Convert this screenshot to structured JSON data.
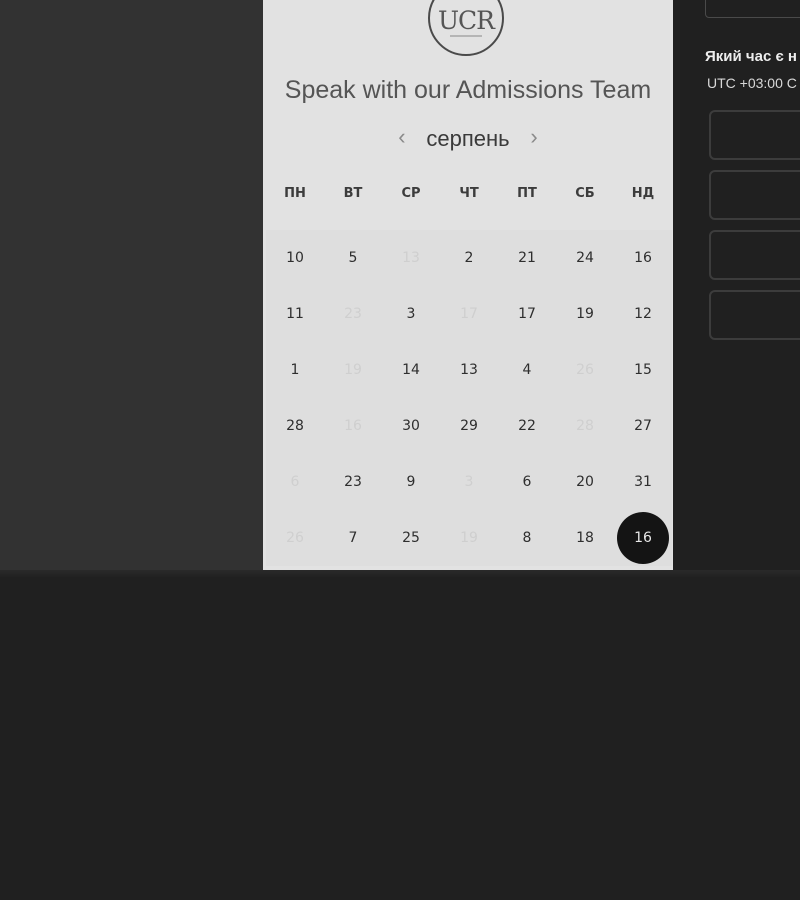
{
  "scheduler": {
    "logo_text": "UCR",
    "title": "Speak with our Admissions Team",
    "month": "серпень",
    "prev_icon": "‹",
    "next_icon": "›",
    "weekdays": [
      "ПН",
      "ВТ",
      "СР",
      "ЧТ",
      "ПТ",
      "СБ",
      "НД"
    ],
    "weeks": [
      [
        {
          "d": "10",
          "s": "e"
        },
        {
          "d": "5",
          "s": "e"
        },
        {
          "d": "13",
          "s": "d"
        },
        {
          "d": "2",
          "s": "e"
        },
        {
          "d": "21",
          "s": "e"
        },
        {
          "d": "24",
          "s": "e"
        },
        {
          "d": "16",
          "s": "e"
        }
      ],
      [
        {
          "d": "11",
          "s": "e"
        },
        {
          "d": "23",
          "s": "d"
        },
        {
          "d": "3",
          "s": "e"
        },
        {
          "d": "17",
          "s": "d"
        },
        {
          "d": "17",
          "s": "e"
        },
        {
          "d": "19",
          "s": "e"
        },
        {
          "d": "12",
          "s": "e"
        }
      ],
      [
        {
          "d": "1",
          "s": "e"
        },
        {
          "d": "19",
          "s": "d"
        },
        {
          "d": "14",
          "s": "e"
        },
        {
          "d": "13",
          "s": "e"
        },
        {
          "d": "4",
          "s": "e"
        },
        {
          "d": "26",
          "s": "d"
        },
        {
          "d": "15",
          "s": "e"
        }
      ],
      [
        {
          "d": "28",
          "s": "e"
        },
        {
          "d": "16",
          "s": "d"
        },
        {
          "d": "30",
          "s": "e"
        },
        {
          "d": "29",
          "s": "e"
        },
        {
          "d": "22",
          "s": "e"
        },
        {
          "d": "28",
          "s": "d"
        },
        {
          "d": "27",
          "s": "e"
        }
      ],
      [
        {
          "d": "6",
          "s": "d"
        },
        {
          "d": "23",
          "s": "e"
        },
        {
          "d": "9",
          "s": "e"
        },
        {
          "d": "3",
          "s": "d"
        },
        {
          "d": "6",
          "s": "e"
        },
        {
          "d": "20",
          "s": "e"
        },
        {
          "d": "31",
          "s": "e"
        }
      ],
      [
        {
          "d": "26",
          "s": "d"
        },
        {
          "d": "7",
          "s": "e"
        },
        {
          "d": "25",
          "s": "e"
        },
        {
          "d": "19",
          "s": "d"
        },
        {
          "d": "8",
          "s": "e"
        },
        {
          "d": "18",
          "s": "e"
        },
        {
          "d": "16",
          "s": "sel"
        }
      ]
    ]
  },
  "timezone": {
    "question": "Який час є н",
    "value": "UTC +03:00 С"
  }
}
